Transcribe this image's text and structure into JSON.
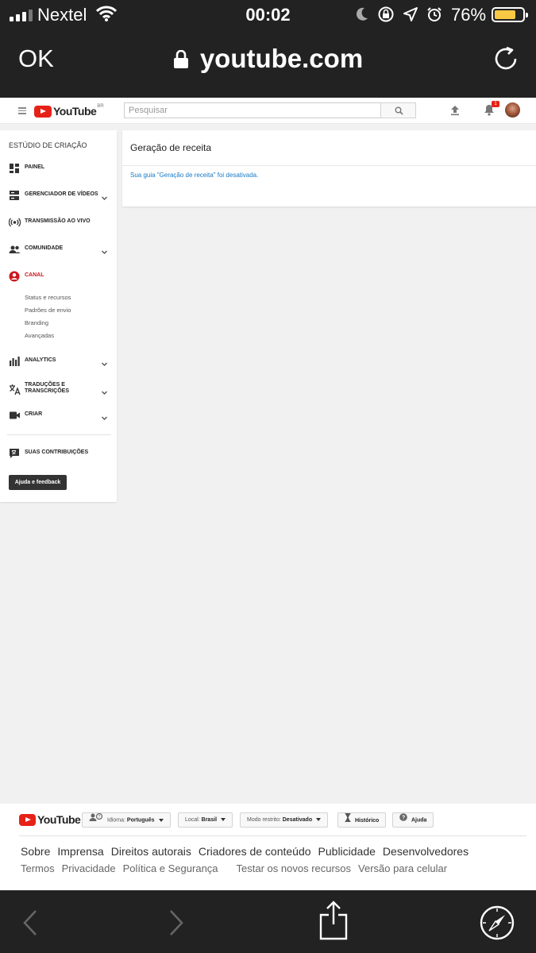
{
  "status_bar": {
    "carrier": "Nextel",
    "time": "00:02",
    "battery_percent": "76%",
    "battery_level": 0.76,
    "battery_color": "#f7c843"
  },
  "safari": {
    "ok_label": "OK",
    "url": "youtube.com"
  },
  "header": {
    "logo_text": "YouTube",
    "region": "BR",
    "search_placeholder": "Pesquisar",
    "notification_count": "1"
  },
  "sidebar": {
    "title": "ESTÚDIO DE CRIAÇÃO",
    "items": [
      {
        "label": "PAINEL",
        "icon": "dashboard-icon"
      },
      {
        "label": "GERENCIADOR DE VÍDEOS",
        "icon": "video-manager-icon"
      },
      {
        "label": "TRANSMISSÃO AO VIVO",
        "icon": "live-stream-icon"
      },
      {
        "label": "COMUNIDADE",
        "icon": "community-icon"
      },
      {
        "label": "CANAL",
        "icon": "channel-icon"
      },
      {
        "label": "ANALYTICS",
        "icon": "analytics-icon"
      },
      {
        "label_line1": "TRADUÇÕES E",
        "label_line2": "TRANSCRIÇÕES",
        "icon": "translate-icon"
      },
      {
        "label": "CRIAR",
        "icon": "create-icon"
      },
      {
        "label": "SUAS CONTRIBUIÇÕES",
        "icon": "contributions-icon"
      }
    ],
    "sub_items": [
      "Status e recursos",
      "Padrões de envio",
      "Branding",
      "Avançadas"
    ],
    "help_button": "Ajuda e feedback"
  },
  "content": {
    "title": "Geração de receita",
    "message": "Sua guia \"Geração de receita\" foi desativada."
  },
  "footer": {
    "logo_text": "YouTube",
    "language_label": "Idioma:",
    "language_value": "Português",
    "location_label": "Local:",
    "location_value": "Brasil",
    "restricted_label": "Modo restrito:",
    "restricted_value": "Desativado",
    "history": "Histórico",
    "help": "Ajuda",
    "links_primary": [
      "Sobre",
      "Imprensa",
      "Direitos autorais",
      "Criadores de conteúdo",
      "Publicidade",
      "Desenvolvedores"
    ],
    "links_secondary": [
      "Termos",
      "Privacidade",
      "Política e Segurança",
      "Testar os novos recursos",
      "Versão para celular"
    ]
  },
  "colors": {
    "brand_red": "#e62117",
    "active_red": "#cc181e",
    "link_blue": "#167ac6",
    "chrome_dark": "#222222"
  }
}
